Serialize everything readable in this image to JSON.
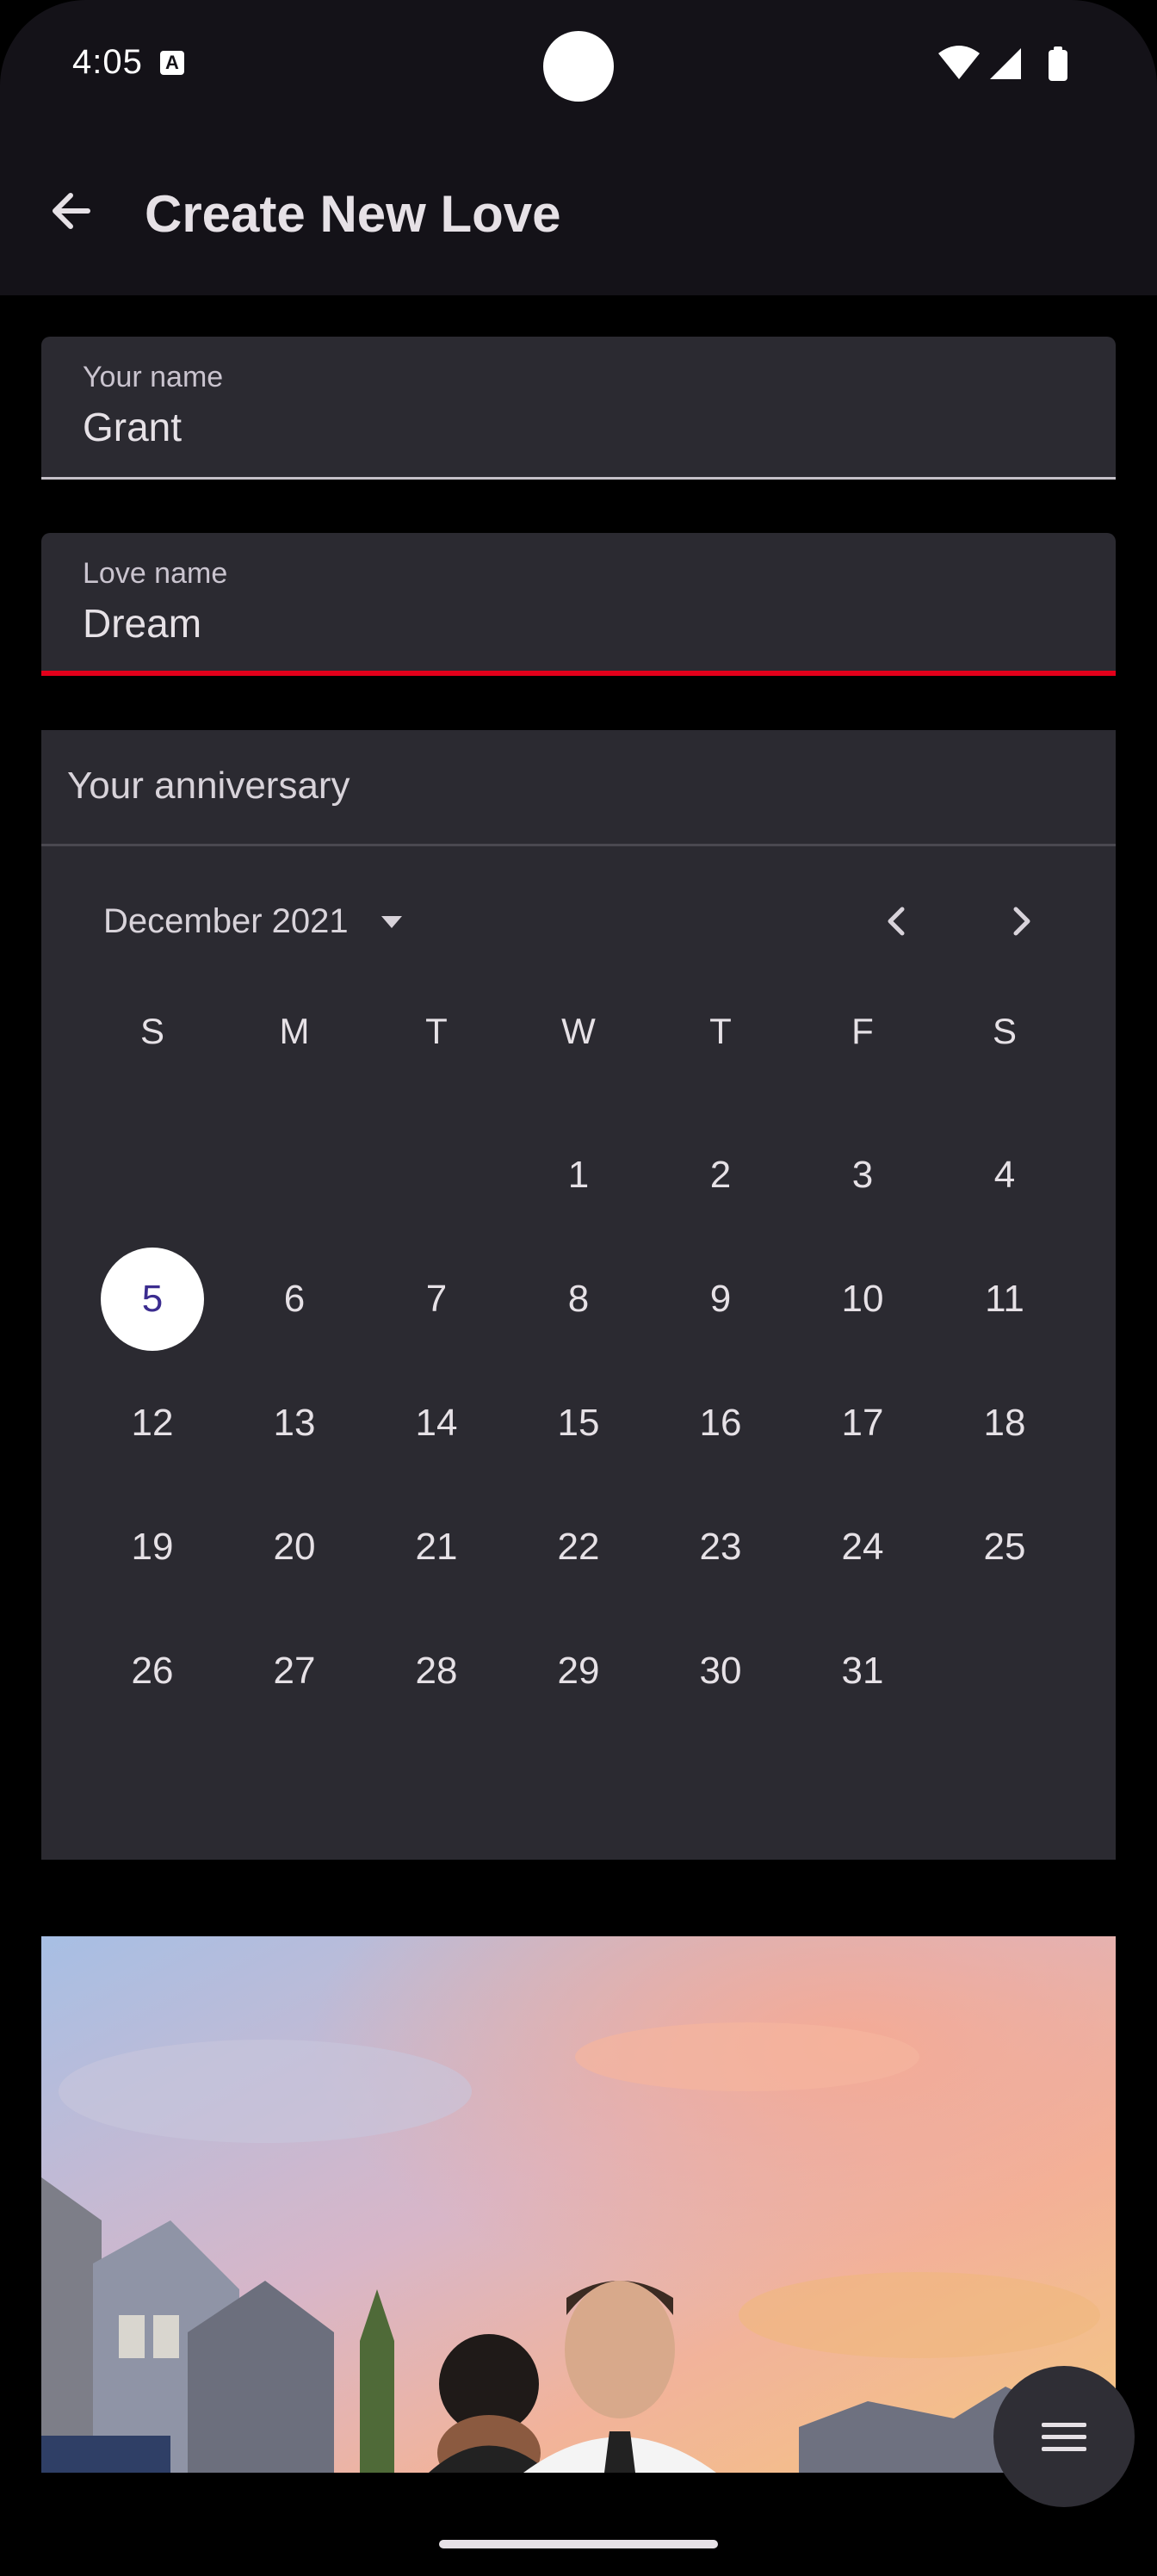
{
  "status_bar": {
    "time": "4:05",
    "notification_icon": "a-box-icon",
    "icons": [
      "wifi-icon",
      "cell-signal-icon",
      "battery-icon"
    ]
  },
  "app_bar": {
    "back_icon": "arrow-left-icon",
    "title": "Create New Love"
  },
  "fields": {
    "your_name": {
      "label": "Your name",
      "value": "Grant"
    },
    "love_name": {
      "label": "Love name",
      "value": "Dream"
    }
  },
  "calendar": {
    "header": "Your anniversary",
    "month_label": "December 2021",
    "weekdays": [
      "S",
      "M",
      "T",
      "W",
      "T",
      "F",
      "S"
    ],
    "weeks": [
      [
        "",
        "",
        "",
        "1",
        "2",
        "3",
        "4"
      ],
      [
        "5",
        "6",
        "7",
        "8",
        "9",
        "10",
        "11"
      ],
      [
        "12",
        "13",
        "14",
        "15",
        "16",
        "17",
        "18"
      ],
      [
        "19",
        "20",
        "21",
        "22",
        "23",
        "24",
        "25"
      ],
      [
        "26",
        "27",
        "28",
        "29",
        "30",
        "31",
        ""
      ]
    ],
    "selected_day": "5"
  },
  "photo": {
    "icon": "couple-photo"
  },
  "fab": {
    "icon": "menu-icon"
  },
  "colors": {
    "background": "#000000",
    "surface": "#2b2a31",
    "app_bar": "#141218",
    "error_underline": "#e3001b",
    "selected_day_bg": "#ffffff",
    "selected_day_text": "#3b2c8f"
  }
}
